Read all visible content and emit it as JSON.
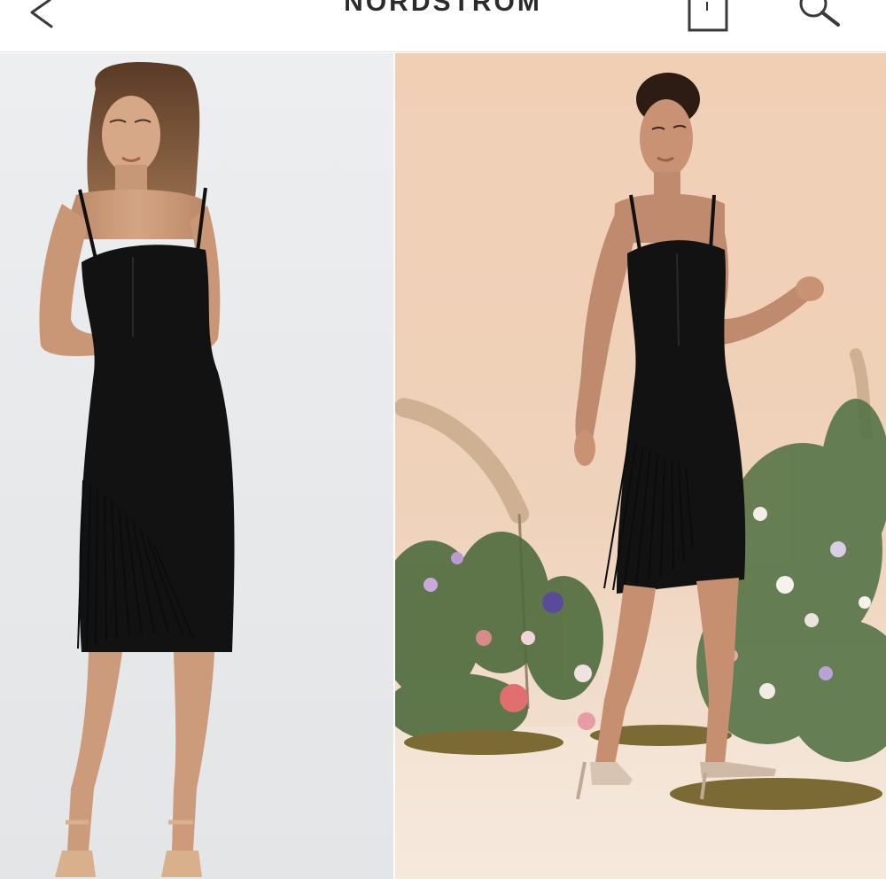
{
  "header": {
    "brand": "NORDSTROM",
    "back_icon": "chevron-left-icon",
    "bag_icon": "shopping-bag-icon",
    "search_icon": "search-icon"
  },
  "gallery": {
    "photos": [
      {
        "name": "studio-front-view"
      },
      {
        "name": "floral-set-walking-view"
      }
    ]
  },
  "colors": {
    "background_left": "#e8eaec",
    "background_right": "#f0d2ba",
    "dress": "#121212",
    "skin": "#c99a7a"
  }
}
